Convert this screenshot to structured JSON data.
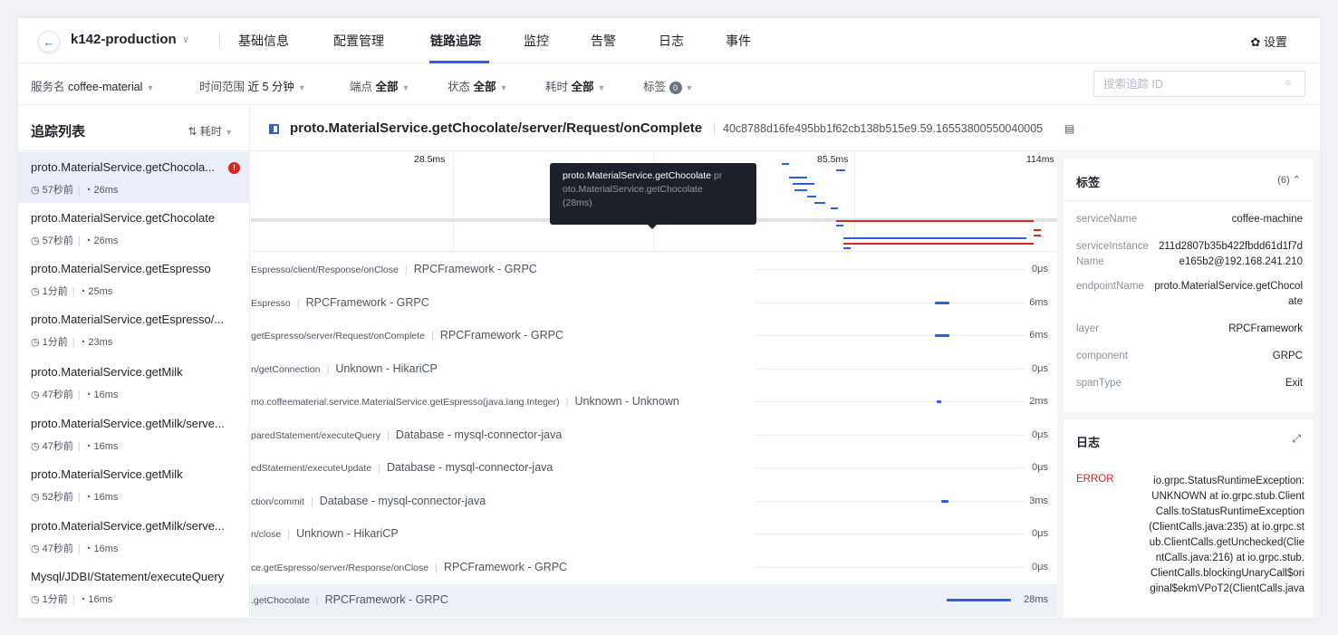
{
  "nav": {
    "app_name": "k142-production",
    "tabs": [
      "基础信息",
      "配置管理",
      "链路追踪",
      "监控",
      "告警",
      "日志",
      "事件"
    ],
    "settings": "设置"
  },
  "filters": {
    "service_label": "服务名",
    "service_value": "coffee-material",
    "time_label": "时间范围",
    "time_value": "近 5 分钟",
    "endpoint_label": "端点",
    "endpoint_value": "全部",
    "status_label": "状态",
    "status_value": "全部",
    "duration_label": "耗时",
    "duration_value": "全部",
    "tags_label": "标签",
    "tags_count": "0",
    "search_placeholder": "搜索追踪 ID"
  },
  "trace_list": {
    "title": "追踪列表",
    "sort_label": "耗时",
    "items": [
      {
        "name": "proto.MaterialService.getChocola...",
        "time": "57秒前",
        "duration": "26ms"
      },
      {
        "name": "proto.MaterialService.getChocolate",
        "time": "57秒前",
        "duration": "26ms"
      },
      {
        "name": "proto.MaterialService.getEspresso",
        "time": "1分前",
        "duration": "25ms"
      },
      {
        "name": "proto.MaterialService.getEspresso/...",
        "time": "1分前",
        "duration": "23ms"
      },
      {
        "name": "proto.MaterialService.getMilk",
        "time": "47秒前",
        "duration": "16ms"
      },
      {
        "name": "proto.MaterialService.getMilk/serve...",
        "time": "47秒前",
        "duration": "16ms"
      },
      {
        "name": "proto.MaterialService.getMilk",
        "time": "52秒前",
        "duration": "16ms"
      },
      {
        "name": "proto.MaterialService.getMilk/serve...",
        "time": "47秒前",
        "duration": "16ms"
      },
      {
        "name": "Mysql/JDBI/Statement/executeQuery",
        "time": "1分前",
        "duration": "16ms"
      }
    ]
  },
  "operation": {
    "title": "proto.MaterialService.getChocolate/server/Request/onComplete",
    "trace_id": "40c8788d16fe495bb1f62cb138b515e9.59.16553800550040005"
  },
  "timeline": {
    "ticks": [
      "28.5ms",
      "85.5ms",
      "114ms"
    ],
    "tooltip_name": "proto.MaterialService.getChocolate",
    "tooltip_detail_a": "pr",
    "tooltip_detail_b": "oto.MaterialService.getChocolate",
    "tooltip_duration": "(28ms)"
  },
  "spans": [
    {
      "name": "Espresso/client/Response/onClose",
      "type": "RPCFramework - GRPC",
      "duration": "0μs",
      "bar_start": 0,
      "bar_width": 0
    },
    {
      "name": "Espresso",
      "type": "RPCFramework - GRPC",
      "duration": "6ms",
      "bar_start": 0.667,
      "bar_width": 0.054
    },
    {
      "name": "getEspresso/server/Request/onComplete",
      "type": "RPCFramework - GRPC",
      "duration": "6ms",
      "bar_start": 0.667,
      "bar_width": 0.054
    },
    {
      "name": "n/getConnection",
      "type": "Unknown - HikariCP",
      "duration": "0μs",
      "bar_start": 0,
      "bar_width": 0
    },
    {
      "name": "mo.coffeematerial.service.MaterialService.getEspresso(java.lang.Integer)",
      "type": "Unknown - Unknown",
      "duration": "2ms",
      "bar_start": 0.673,
      "bar_width": 0.018
    },
    {
      "name": "paredStatement/executeQuery",
      "type": "Database - mysql-connector-java",
      "duration": "0μs",
      "bar_start": 0,
      "bar_width": 0
    },
    {
      "name": "edStatement/executeUpdate",
      "type": "Database - mysql-connector-java",
      "duration": "0μs",
      "bar_start": 0,
      "bar_width": 0
    },
    {
      "name": "ction/commit",
      "type": "Database - mysql-connector-java",
      "duration": "3ms",
      "bar_start": 0.69,
      "bar_width": 0.027
    },
    {
      "name": "n/close",
      "type": "Unknown - HikariCP",
      "duration": "0μs",
      "bar_start": 0,
      "bar_width": 0
    },
    {
      "name": "ce.getEspresso/server/Response/onClose",
      "type": "RPCFramework - GRPC",
      "duration": "0μs",
      "bar_start": 0,
      "bar_width": 0
    },
    {
      "name": ".getChocolate",
      "type": "RPCFramework - GRPC",
      "duration": "28ms",
      "bar_start": 0.71,
      "bar_width": 0.24
    }
  ],
  "tags": {
    "title": "标签",
    "count": "(6)",
    "items": [
      {
        "key": "serviceName",
        "value": "coffee-machine"
      },
      {
        "key": "serviceInstanceName",
        "value": "211d2807b35b422fbdd61d1f7de165b2@192.168.241.210"
      },
      {
        "key": "endpointName",
        "value": "proto.MaterialService.getChocolate"
      },
      {
        "key": "layer",
        "value": "RPCFramework"
      },
      {
        "key": "component",
        "value": "GRPC"
      },
      {
        "key": "spanType",
        "value": "Exit"
      }
    ]
  },
  "logs": {
    "title": "日志",
    "level": "ERROR",
    "message": "io.grpc.StatusRuntimeException: UNKNOWN at io.grpc.stub.ClientCalls.toStatusRuntimeException(ClientCalls.java:235) at io.grpc.stub.ClientCalls.getUnchecked(ClientCalls.java:216) at io.grpc.stub.ClientCalls.blockingUnaryCall$original$ekmVPoT2(ClientCalls.java"
  },
  "colors": {
    "accent": "#2c5fe6",
    "error": "#d7261c"
  }
}
